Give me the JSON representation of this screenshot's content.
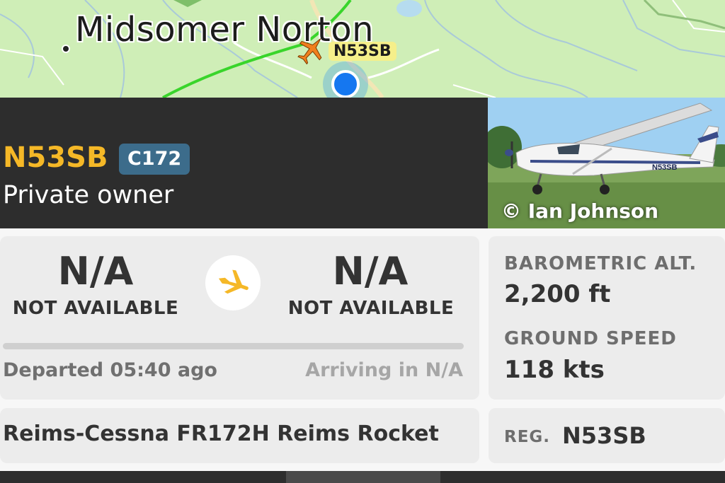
{
  "map": {
    "town_name": "Midsomer Norton",
    "aircraft_label": "N53SB"
  },
  "header": {
    "callsign": "N53SB",
    "aircraft_type_code": "C172",
    "airline": "Private owner",
    "photo_credit": "© Ian Johnson"
  },
  "route": {
    "origin_code": "N/A",
    "origin_name": "NOT AVAILABLE",
    "destination_code": "N/A",
    "destination_name": "NOT AVAILABLE",
    "departed_text": "Departed 05:40 ago",
    "arriving_text": "Arriving in N/A",
    "progress_percent": 0
  },
  "stats": {
    "altitude_label": "BAROMETRIC ALT.",
    "altitude_value": "2,200 ft",
    "speed_label": "GROUND SPEED",
    "speed_value": "118 kts"
  },
  "details": {
    "aircraft_model": "Reims-Cessna FR172H Reims Rocket",
    "reg_label": "REG.",
    "reg_value": "N53SB"
  },
  "colors": {
    "callsign": "#f5b827",
    "badge": "#3c6c8b",
    "flight_path": "#39d52b",
    "location_dot": "#1577f0"
  }
}
